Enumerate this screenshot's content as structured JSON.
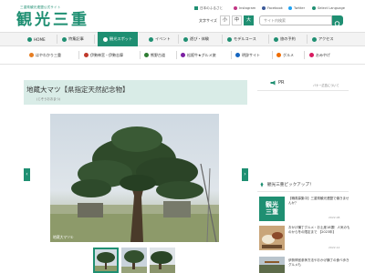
{
  "header": {
    "tagline": "三重県観光連盟公式サイト",
    "logo": "観光三重",
    "top_links": [
      {
        "label": "日本のふるさと",
        "color": "#1f8f72"
      },
      {
        "label": "Instagram",
        "color": "#c13584"
      },
      {
        "label": "Facebook",
        "color": "#3b5998"
      },
      {
        "label": "Twitter",
        "color": "#1da1f2"
      },
      {
        "label": "Select Language",
        "color": "#1f8f72"
      }
    ],
    "font_size_label": "文字サイズ",
    "font_sizes": [
      "小",
      "中",
      "大"
    ],
    "selected_font_size": "大",
    "search_placeholder": "サイト内検索"
  },
  "nav_primary": [
    {
      "label": "HOME",
      "icon": "home-icon"
    },
    {
      "label": "特集記事",
      "icon": "star-icon"
    },
    {
      "label": "観光スポット",
      "icon": "spot-icon",
      "active": true
    },
    {
      "label": "イベント",
      "icon": "event-icon"
    },
    {
      "label": "遊び・体験",
      "icon": "play-icon"
    },
    {
      "label": "モデルコース",
      "icon": "course-icon"
    },
    {
      "label": "旅の予約",
      "icon": "reserve-icon"
    },
    {
      "label": "アクセス",
      "icon": "access-icon"
    }
  ],
  "nav_secondary": [
    {
      "label": "はやわかり三重",
      "icon": "map-icon"
    },
    {
      "label": "伊勢神宮・伊勢志摩",
      "icon": "shrine-icon"
    },
    {
      "label": "熊野古道",
      "icon": "path-icon"
    },
    {
      "label": "松阪牛★グルメ旅",
      "icon": "beef-icon"
    },
    {
      "label": "明辞サイト",
      "icon": "info-icon"
    },
    {
      "label": "グルメ",
      "icon": "food-icon"
    },
    {
      "label": "おみやげ",
      "icon": "gift-icon"
    }
  ],
  "main": {
    "title": "地蔵大マツ【県指定天然記念物】",
    "ruby": "(じぞうおおまつ)",
    "photo_caption": "地蔵大マツ①",
    "thumb_count": 3,
    "selected_thumb": 1
  },
  "sidebar": {
    "pr_label": "PR",
    "pr_note": "バナー広告について",
    "pickup_title": "観光三重ピックアップ！",
    "pickup": [
      {
        "text": "【職員募集中】三重県観光連盟で働きませんか？",
        "date": "2022.08",
        "icon": "logo-thumb-icon"
      },
      {
        "text": "おかげ横丁グルメ・お土産18選！人気のものから冬の限定まで 【2023年】",
        "date": "2022.12",
        "icon": "food-thumb-icon"
      },
      {
        "text": "伊勢神宮参拝方法やおかげ横丁の食べ歩きグルメも",
        "date": "",
        "icon": "shrine-thumb-icon"
      }
    ]
  }
}
